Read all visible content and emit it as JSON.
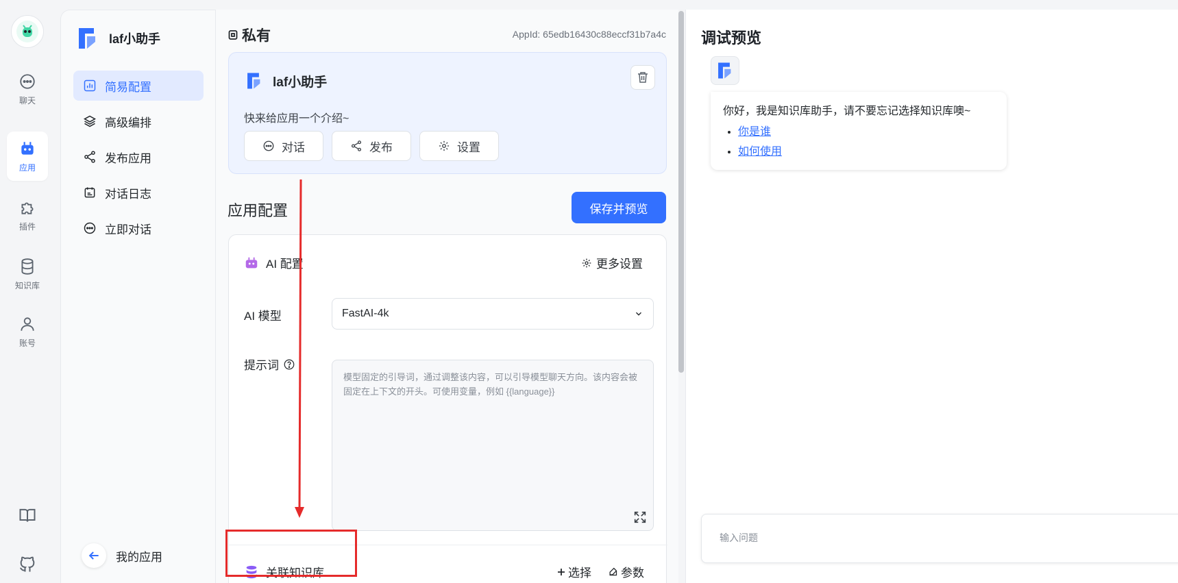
{
  "rail": {
    "items": [
      {
        "label": "聊天",
        "icon": "chat-icon"
      },
      {
        "label": "应用",
        "icon": "robot-icon"
      },
      {
        "label": "插件",
        "icon": "puzzle-icon"
      },
      {
        "label": "知识库",
        "icon": "database-icon"
      },
      {
        "label": "账号",
        "icon": "user-icon"
      }
    ],
    "bottom": [
      {
        "icon": "book-icon"
      },
      {
        "icon": "github-icon"
      }
    ],
    "active_index": 1
  },
  "sidebar": {
    "app_name": "laf小助手",
    "items": [
      {
        "label": "简易配置",
        "icon": "chart-bar-icon"
      },
      {
        "label": "高级编排",
        "icon": "layers-icon"
      },
      {
        "label": "发布应用",
        "icon": "share-icon"
      },
      {
        "label": "对话日志",
        "icon": "calendar-log-icon"
      },
      {
        "label": "立即对话",
        "icon": "chat-icon"
      }
    ],
    "active_index": 0,
    "back_label": "我的应用"
  },
  "main": {
    "visibility": "私有",
    "app_id": "AppId: 65edb16430c88eccf31b7a4c",
    "app_card": {
      "name": "laf小助手",
      "intro": "快来给应用一个介绍~",
      "buttons": [
        "对话",
        "发布",
        "设置"
      ]
    },
    "config_title": "应用配置",
    "save_label": "保存并预览",
    "ai_config": {
      "title": "AI 配置",
      "more_settings": "更多设置",
      "model_label": "AI 模型",
      "model_value": "FastAI-4k",
      "prompt_label": "提示词",
      "prompt_placeholder": "模型固定的引导词，通过调整该内容，可以引导模型聊天方向。该内容会被固定在上下文的开头。可使用变量，例如 {{language}}"
    },
    "kb": {
      "label": "关联知识库",
      "select_label": "选择",
      "params_label": "参数"
    }
  },
  "preview": {
    "title": "调试预览",
    "greeting": "你好，我是知识库助手，请不要忘记选择知识库噢~",
    "links": [
      "你是谁",
      "如何使用"
    ],
    "input_placeholder": "输入问题"
  },
  "colors": {
    "accent": "#3370ff",
    "annotation_red": "#e52b2b",
    "kb_icon": "#8a5cf6"
  }
}
